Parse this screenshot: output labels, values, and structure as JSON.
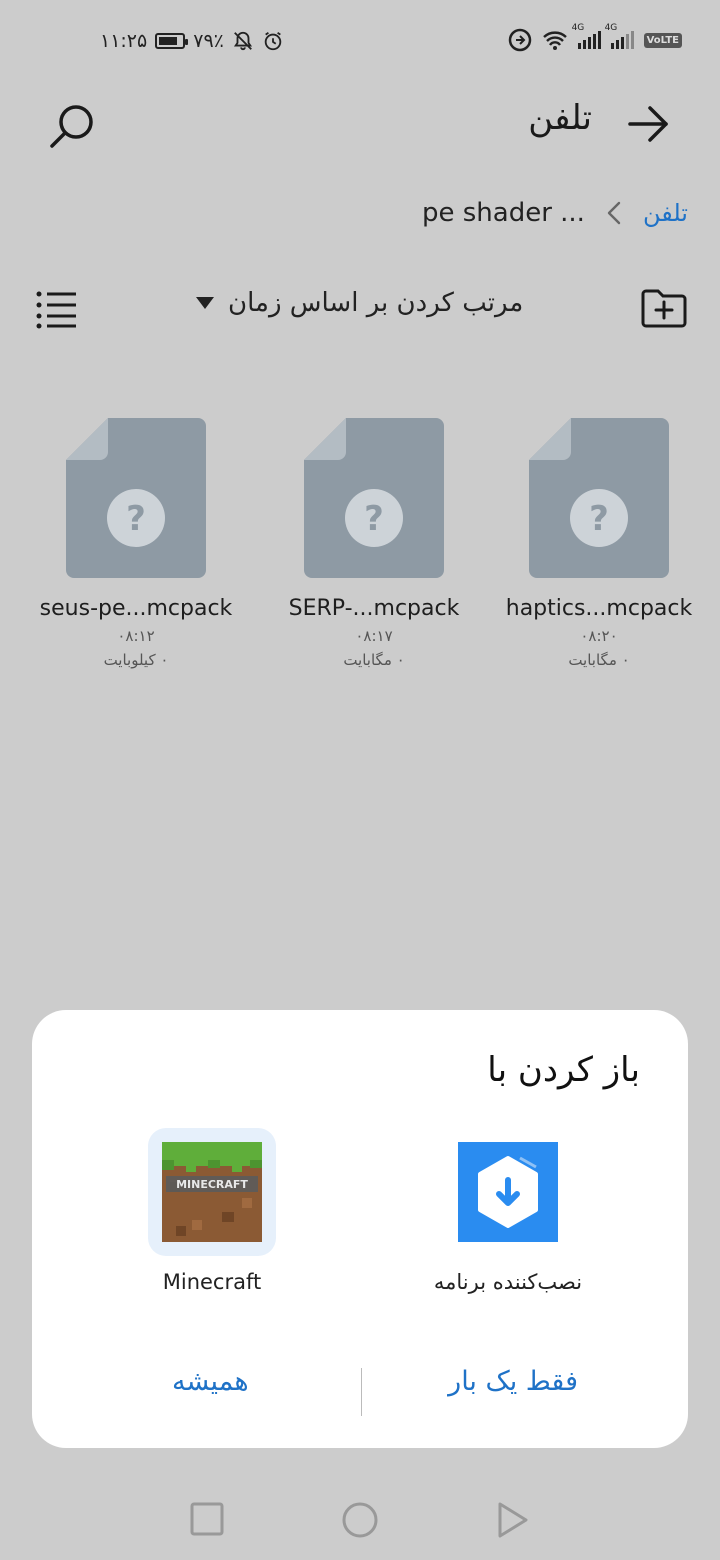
{
  "status_bar": {
    "time": "۱۱:۲۵",
    "battery_text": "۷۹٪",
    "battery_level": 0.79,
    "network_label_1": "4G",
    "network_label_2": "4G",
    "volte": "VoLTE"
  },
  "header": {
    "title": "تلفن",
    "back_icon": "arrow-right-icon",
    "search_icon": "search-icon"
  },
  "breadcrumb": {
    "root": "تلفن",
    "current": "pe shader ..."
  },
  "toolbar": {
    "sort_label": "مرتب کردن بر اساس زمان",
    "new_folder_icon": "new-folder-icon",
    "view_icon": "list-view-icon"
  },
  "files": [
    {
      "name": "haptics...mcpack",
      "time": "۰۸:۲۰",
      "size": "۰ مگابایت"
    },
    {
      "name": "SERP-...mcpack",
      "time": "۰۸:۱۷",
      "size": "۰ مگابایت"
    },
    {
      "name": "seus-pe...mcpack",
      "time": "۰۸:۱۲",
      "size": "۰ کیلوبایت"
    }
  ],
  "sheet": {
    "title": "باز کردن با",
    "apps": [
      {
        "label": "نصب‌کننده برنامه",
        "icon": "package-installer-icon"
      },
      {
        "label": "Minecraft",
        "icon": "minecraft-icon",
        "logo_text": "MINECRAFT"
      }
    ],
    "just_once": "فقط یک بار",
    "always": "همیشه"
  },
  "colors": {
    "accent": "#1f72c7",
    "background": "#cccccc",
    "file_icon": "#8e9aa4"
  }
}
